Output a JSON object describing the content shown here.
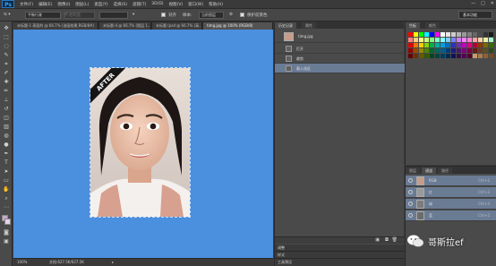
{
  "app": {
    "logo": "Ps"
  },
  "menu": [
    "文件(F)",
    "编辑(E)",
    "图像(I)",
    "图层(L)",
    "类型(Y)",
    "选择(S)",
    "滤镜(T)",
    "3D(D)",
    "视图(V)",
    "窗口(W)",
    "帮助(H)"
  ],
  "window_controls": [
    "—",
    "□",
    "✕"
  ],
  "options": {
    "mode_select": "平衡行驶",
    "label_opacity": "不透明度:",
    "label_size": "大小:",
    "label_align": "对齐",
    "label_sample": "样本:",
    "sample_select": "当前图层",
    "label_protect": "保护前景色",
    "workspace": "基本功能"
  },
  "tabs": [
    "未标题-1 表面的 @ 66.7% (油画效果,RGB/8#)",
    "未标题-4 @ 66.7% (图层 1...",
    "未标题 (psd @ 66.7% (高...",
    "timg.jpg @ 100% (RGB/8)"
  ],
  "canvas": {
    "photo_label": "AFTER"
  },
  "status": {
    "zoom": "100%",
    "doc": "文档:627.5K/627.5K"
  },
  "history_panel": {
    "tabs": [
      "历史记录",
      "属性"
    ],
    "snapshot": "timg.jpg",
    "rows": [
      "打开",
      "裁剪",
      "载入选区"
    ]
  },
  "side_collapsed": [
    "调整",
    "样式",
    "工具预设"
  ],
  "swatches_panel": {
    "tabs": [
      "色板",
      "颜色"
    ],
    "colors": [
      "#ff0000",
      "#ffff00",
      "#00ff00",
      "#00ffff",
      "#0000ff",
      "#ff00ff",
      "#ffffff",
      "#e6e6e6",
      "#cccccc",
      "#b3b3b3",
      "#999999",
      "#808080",
      "#666666",
      "#4d4d4d",
      "#333333",
      "#1a1a1a",
      "#ff8080",
      "#ffcc80",
      "#fff280",
      "#c8ff80",
      "#80ff80",
      "#80ffcc",
      "#80ffff",
      "#80ccff",
      "#8080ff",
      "#cc80ff",
      "#ff80ff",
      "#ff80cc",
      "#f2a6a6",
      "#f2d2a6",
      "#e8f2a6",
      "#a6f2c8",
      "#e60000",
      "#f27200",
      "#f2d100",
      "#8ad100",
      "#00b050",
      "#00b0a0",
      "#00a0e0",
      "#0070c0",
      "#3030c0",
      "#7030a0",
      "#c000c0",
      "#e0007a",
      "#b0003a",
      "#8c3a00",
      "#7a6a00",
      "#3a6a00",
      "#990000",
      "#994c00",
      "#998600",
      "#4c8600",
      "#006633",
      "#006660",
      "#005c8a",
      "#003d7a",
      "#1a1a80",
      "#4a1a66",
      "#800080",
      "#800040",
      "#661a1a",
      "#664020",
      "#5c5020",
      "#2a4a1a",
      "#660000",
      "#663300",
      "#665a00",
      "#335a00",
      "#004422",
      "#004440",
      "#003d5c",
      "#002a52",
      "#111155",
      "#321144",
      "#550055",
      "#55002a",
      "#c69c6d",
      "#a67c52",
      "#8c6239",
      "#754c24"
    ]
  },
  "channels_panel": {
    "tabs": [
      "图层",
      "通道",
      "路径"
    ],
    "rows": [
      {
        "name": "RGB",
        "shortcut": "Ctrl+2"
      },
      {
        "name": "红",
        "shortcut": "Ctrl+3"
      },
      {
        "name": "绿",
        "shortcut": "Ctrl+4"
      },
      {
        "name": "蓝",
        "shortcut": "Ctrl+5"
      }
    ]
  },
  "watermark": {
    "text": "哥斯拉ef"
  },
  "colors": {
    "canvas_bg": "#4b8fdf",
    "selection": "#6a7b94"
  }
}
